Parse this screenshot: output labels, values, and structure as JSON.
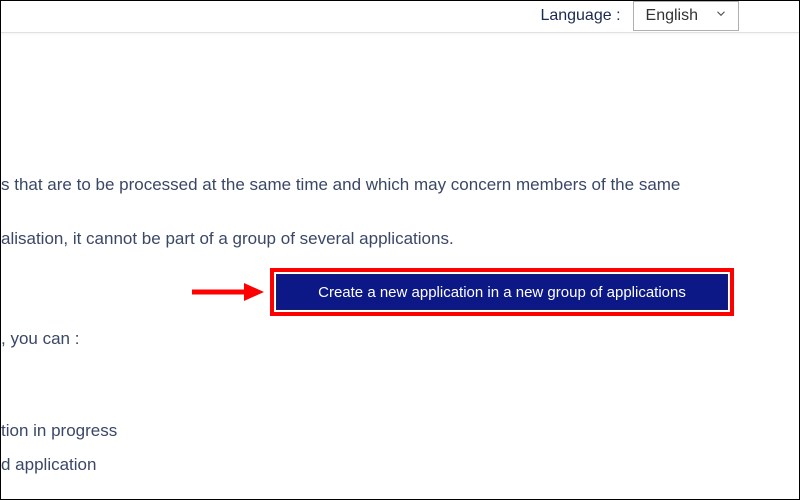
{
  "header": {
    "language_label": "Language :",
    "language_value": "English"
  },
  "body": {
    "line1": "s that are to be processed at the same time and which may concern members of the same",
    "line2": "alisation, it cannot be part of a group of several applications.",
    "line3": ", you can :",
    "line4": "tion in progress",
    "line5": "d application"
  },
  "cta": {
    "label": "Create a new application in a new group of applications"
  },
  "annotation": {
    "highlight_color": "#ff0000",
    "arrow_color": "#ff0000"
  }
}
